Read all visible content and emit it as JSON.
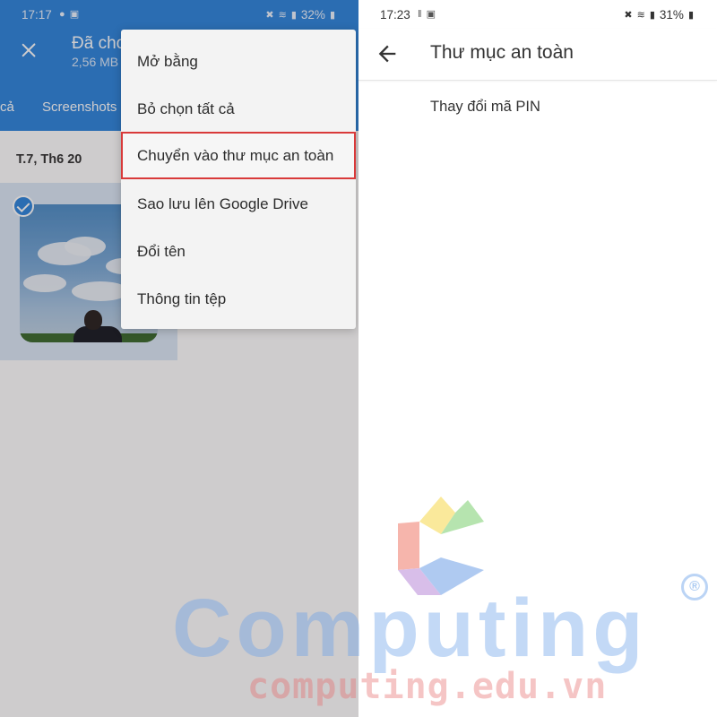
{
  "left_screen": {
    "status_bar": {
      "time": "17:17",
      "left_icons": "chat-icon image-icon",
      "battery": "32%"
    },
    "app_bar": {
      "title": "Đã cho",
      "subtitle": "2,56 MB"
    },
    "tabs": [
      {
        "label": "cả"
      },
      {
        "label": "Screenshots"
      }
    ],
    "date_header": "T.7, Th6 20",
    "photo": {
      "selected": true
    },
    "menu": {
      "items": [
        {
          "label": "Mở bằng"
        },
        {
          "label": "Bỏ chọn tất cả"
        },
        {
          "label": "Chuyển vào thư mục an toàn",
          "highlighted": true
        },
        {
          "label": "Sao lưu lên Google Drive"
        },
        {
          "label": "Đổi tên"
        },
        {
          "label": "Thông tin tệp"
        }
      ]
    }
  },
  "right_screen": {
    "status_bar": {
      "time": "17:23",
      "battery": "31%"
    },
    "app_bar": {
      "title": "Thư mục an toàn"
    },
    "items": [
      {
        "label": "Thay đổi mã PIN"
      }
    ]
  },
  "watermark": {
    "word": "Computing",
    "url": "computing.edu.vn",
    "reg_mark": "®"
  },
  "colors": {
    "primary_blue": "#2f86dd",
    "highlight_red": "#d93a3a"
  }
}
